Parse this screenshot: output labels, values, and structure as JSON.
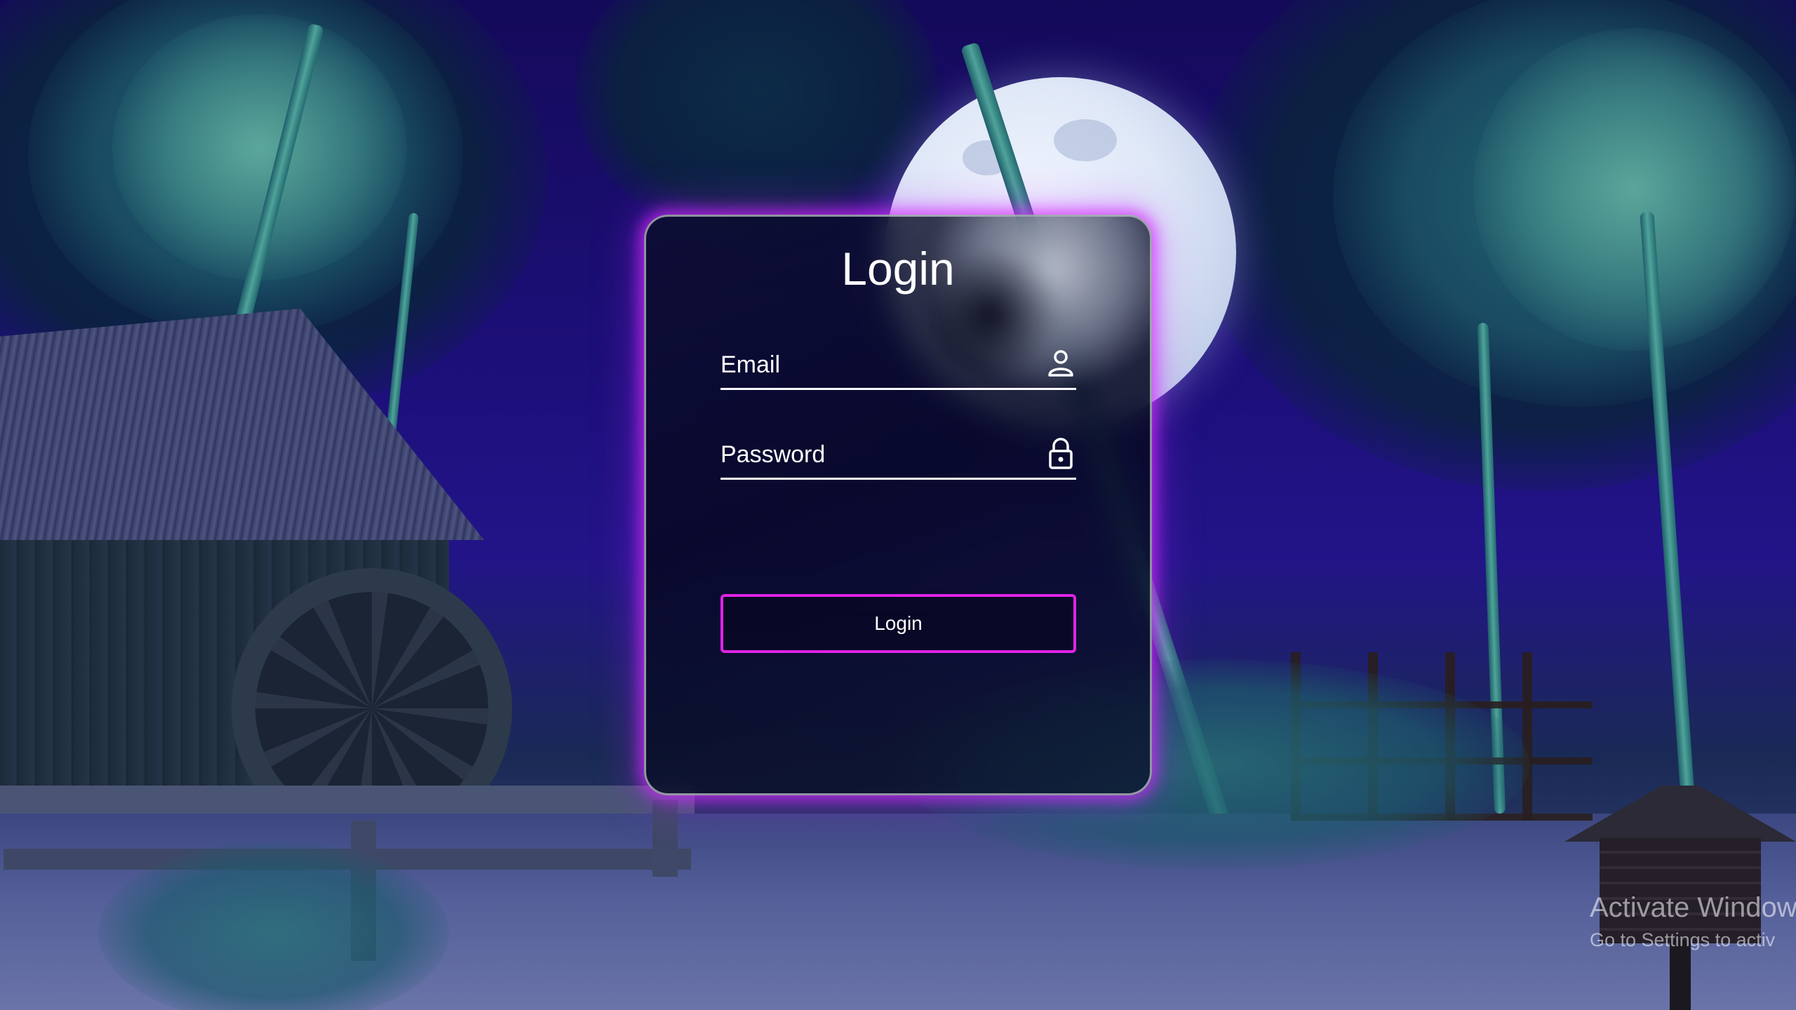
{
  "login_card": {
    "title": "Login",
    "email": {
      "placeholder": "Email",
      "icon": "user-icon"
    },
    "password": {
      "placeholder": "Password",
      "icon": "lock-icon"
    },
    "submit_label": "Login"
  },
  "watermark": {
    "title": "Activate Window",
    "subtitle": "Go to Settings to activ"
  },
  "colors": {
    "accent": "#e023e6",
    "card_glow": "#d628ff",
    "text": "#ffffff",
    "sky": "#1c0f78"
  }
}
